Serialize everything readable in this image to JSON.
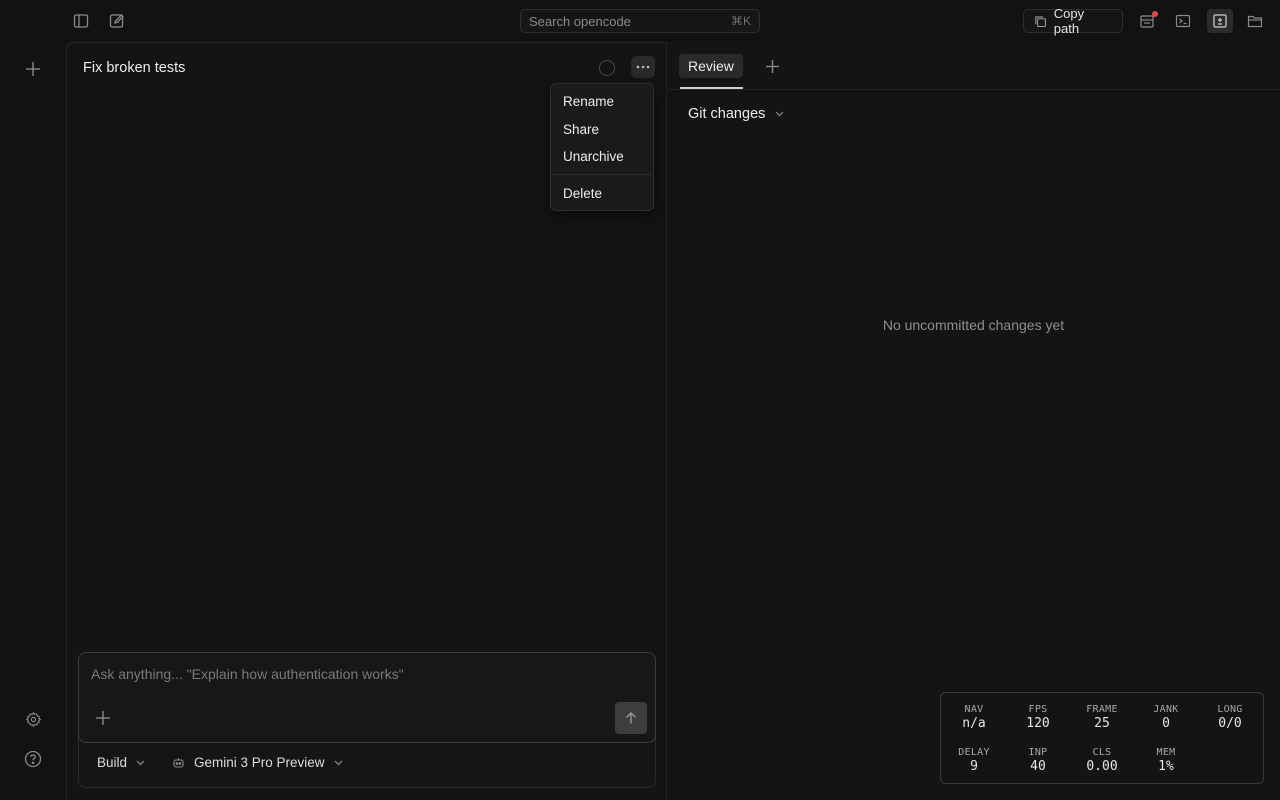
{
  "header": {
    "search_placeholder": "Search opencode",
    "search_shortcut": "⌘K",
    "copy_path_label": "Copy path"
  },
  "session": {
    "title": "Fix broken tests",
    "menu": {
      "items": [
        "Rename",
        "Share",
        "Unarchive"
      ],
      "danger_item": "Delete"
    }
  },
  "composer": {
    "placeholder": "Ask anything... \"Explain how authentication works\"",
    "agent": "Build",
    "model": "Gemini 3 Pro Preview"
  },
  "review": {
    "tab_label": "Review",
    "section_label": "Git changes",
    "empty_message": "No uncommitted changes yet"
  },
  "perf": {
    "row1": [
      {
        "label": "NAV",
        "value": "n/a"
      },
      {
        "label": "FPS",
        "value": "120"
      },
      {
        "label": "FRAME",
        "value": "25"
      },
      {
        "label": "JANK",
        "value": "0"
      },
      {
        "label": "LONG",
        "value": "0/0"
      }
    ],
    "row2": [
      {
        "label": "DELAY",
        "value": "9"
      },
      {
        "label": "INP",
        "value": "40"
      },
      {
        "label": "CLS",
        "value": "0.00"
      },
      {
        "label": "MEM",
        "value": "1%"
      }
    ]
  },
  "icons": {
    "sidebar_toggle": "sidebar-toggle-icon",
    "new_session": "edit-icon",
    "copy": "copy-icon",
    "status": "status-icon",
    "terminal": "terminal-icon",
    "review_panel": "review-panel-icon",
    "folder": "folder-icon",
    "plus": "plus-icon",
    "settings": "gear-icon",
    "help": "help-icon",
    "more": "more-icon",
    "send": "arrow-up-icon",
    "model": "model-icon"
  },
  "colors": {
    "background": "#121212",
    "notification_dot": "#e5484d"
  }
}
